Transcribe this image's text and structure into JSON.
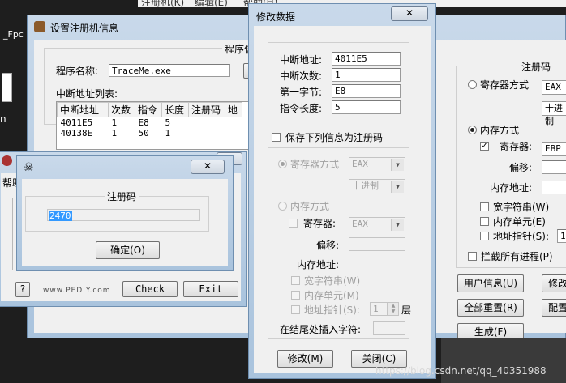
{
  "desktop": {
    "icon_label": "_Fpc",
    "bottom_left_char": "n",
    "watermark": "https://blog.csdn.net/qq_40351988"
  },
  "bg_app": {
    "menu_items": [
      "注册机(K)",
      "编辑(E)",
      "帮助(H)"
    ],
    "title": "设置注册机信息",
    "program_group_title": "程序信",
    "program_name_label": "程序名称:",
    "program_name_value": "TraceMe.exe",
    "break_list_label": "中断地址列表:",
    "columns": [
      "中断地址",
      "次数",
      "指令",
      "长度",
      "注册码",
      "地"
    ],
    "rows": [
      [
        "4011E5",
        "1",
        "E8",
        "5",
        ""
      ],
      [
        "40138E",
        "1",
        "50",
        "1",
        ""
      ]
    ],
    "reg_group_title": "注册码",
    "radio_register": "寄存器方式",
    "reg_combo_value": "EAX",
    "reg_combo2_value": "十进制",
    "radio_memory": "内存方式",
    "chk_register": "寄存器:",
    "reg_mem_combo_value": "EBP",
    "offset_label": "偏移:",
    "mem_addr_label": "内存地址:",
    "chk_wide": "宽字符串(W)",
    "chk_memcell": "内存单元(E)",
    "chk_pointer": "地址指针(S):",
    "pointer_value": "1",
    "chk_intercept": "拦截所有进程(P)",
    "btn_userinfo": "用户信息(U)",
    "btn_modify": "修改",
    "btn_reset": "全部重置(R)",
    "btn_config": "配置",
    "btn_generate": "生成(F)"
  },
  "pediy_dialog": {
    "menu_label": "帮助",
    "help_btn": "?",
    "site": "www.PEDIY.com",
    "check_btn": "Check",
    "exit_btn": "Exit"
  },
  "reg_dialog": {
    "title": "",
    "group_title": "注册码",
    "code_value": "2470",
    "ok_btn": "确定(O)",
    "close_glyph": "X"
  },
  "modify_dialog": {
    "title": "修改数据",
    "close_glyph": "X",
    "break_addr_label": "中断地址:",
    "break_addr_value": "4011E5",
    "break_count_label": "中断次数:",
    "break_count_value": "1",
    "first_byte_label": "第一字节:",
    "first_byte_value": "E8",
    "instr_len_label": "指令长度:",
    "instr_len_value": "5",
    "save_as_reg_label": "保存下列信息为注册码",
    "radio_register": "寄存器方式",
    "reg_combo_value": "EAX",
    "format_combo_value": "十进制",
    "radio_memory": "内存方式",
    "chk_register": "寄存器:",
    "mem_reg_combo_value": "EAX",
    "offset_label": "偏移:",
    "mem_addr_label": "内存地址:",
    "chk_wide": "宽字符串(W)",
    "chk_memcell": "内存单元(M)",
    "chk_pointer": "地址指针(S):",
    "pointer_value": "1",
    "layer_label": "层",
    "insert_label": "在结尾处插入字符:",
    "modify_btn": "修改(M)",
    "close_btn": "关闭(C)"
  },
  "colors": {
    "window_face": "#f0f0f0",
    "title_gradient": "#bcd0e6",
    "selection": "#3399ff"
  }
}
